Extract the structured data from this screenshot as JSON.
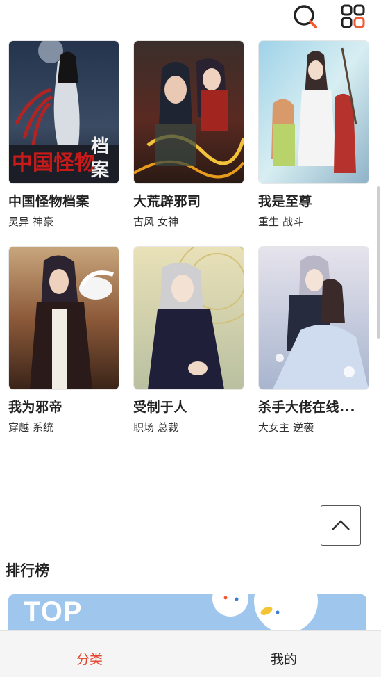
{
  "header": {
    "search_icon": "search-icon",
    "grid_icon": "category-grid-icon",
    "accent_color": "#ef5a32"
  },
  "comics": [
    {
      "title": "中国怪物档案",
      "tags": [
        "灵异",
        "神豪"
      ],
      "cover_text": "中国怪物档案"
    },
    {
      "title": "大荒辟邪司",
      "tags": [
        "古风",
        "女神"
      ]
    },
    {
      "title": "我是至尊",
      "tags": [
        "重生",
        "战斗"
      ]
    },
    {
      "title": "我为邪帝",
      "tags": [
        "穿越",
        "系统"
      ]
    },
    {
      "title": "受制于人",
      "tags": [
        "职场",
        "总裁"
      ]
    },
    {
      "title": "杀手大佬在线...",
      "tags": [
        "大女主",
        "逆袭"
      ]
    }
  ],
  "ranking": {
    "title": "排行榜",
    "banner_text": "TOP"
  },
  "tabbar": {
    "category_label": "分类",
    "mine_label": "我的",
    "active_color": "#e2462e"
  }
}
